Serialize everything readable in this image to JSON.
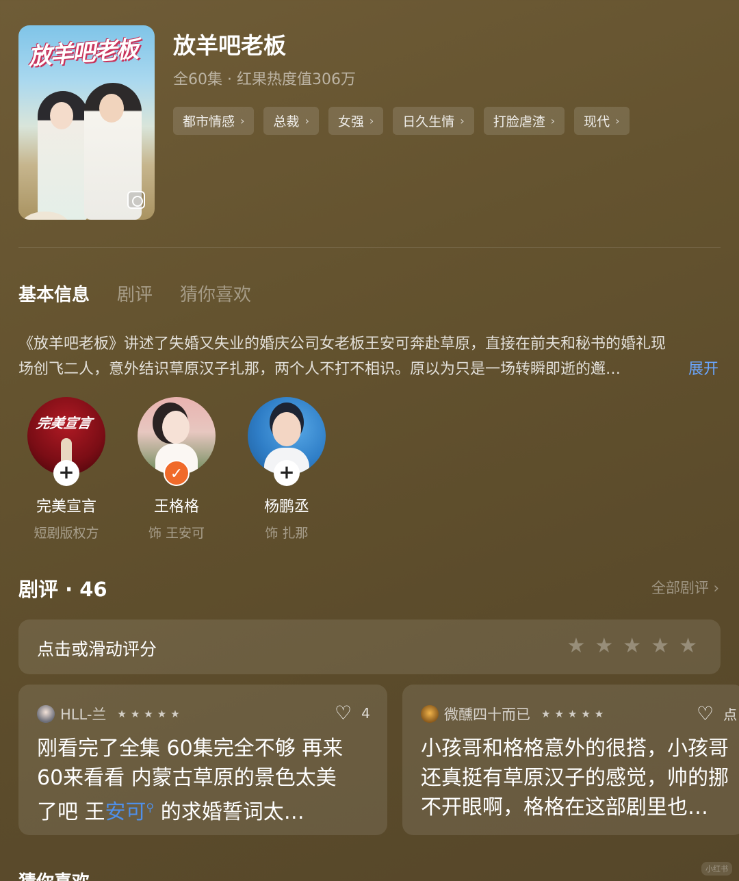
{
  "poster": {
    "title_art": "放羊吧老板"
  },
  "drama": {
    "title": "放羊吧老板",
    "meta": "全60集 · 红果热度值306万",
    "tags": [
      "都市情感",
      "总裁",
      "女强",
      "日久生情",
      "打脸虐渣",
      "现代"
    ]
  },
  "tabs": [
    "基本信息",
    "剧评",
    "猜你喜欢"
  ],
  "description": {
    "line1": "《放羊吧老板》讲述了失婚又失业的婚庆公司女老板王安可奔赴草原，直接在前夫和秘书的婚礼现",
    "line2": "场创飞二人，意外结识草原汉子扎那，两个人不打不相识。原以为只是一场转瞬即逝的邂…",
    "expand": "展开"
  },
  "cast": [
    {
      "name": "完美宣言",
      "role": "短剧版权方",
      "logo_text": "完美宣言",
      "followed": false
    },
    {
      "name": "王格格",
      "role": "饰 王安可",
      "followed": true
    },
    {
      "name": "杨鹏丞",
      "role": "饰 扎那",
      "followed": false
    }
  ],
  "reviews": {
    "title": "剧评 · 46",
    "all_label": "全部剧评",
    "rate_label": "点击或滑动评分",
    "cards": [
      {
        "user": "HLL-兰",
        "likes": "4",
        "line1": "刚看完了全集 60集完全不够 再来",
        "line2": "60来看看 内蒙古草原的景色太美",
        "line3_before": "了吧 王",
        "line3_link": "安可",
        "line3_after": " 的求婚誓词太…"
      },
      {
        "user": "微醺四十而已",
        "likes": "点",
        "line1": "小孩哥和格格意外的很搭，小孩哥",
        "line2": "还真挺有草原汉子的感觉，帅的挪",
        "line3": "不开眼啊，格格在这部剧里也…"
      }
    ]
  },
  "guess_title": "猜你喜欢",
  "watermark": "小红书",
  "colors": {
    "accent_link": "#4f8fe8",
    "follow_done": "#f06a2a",
    "background": "#64532f"
  }
}
